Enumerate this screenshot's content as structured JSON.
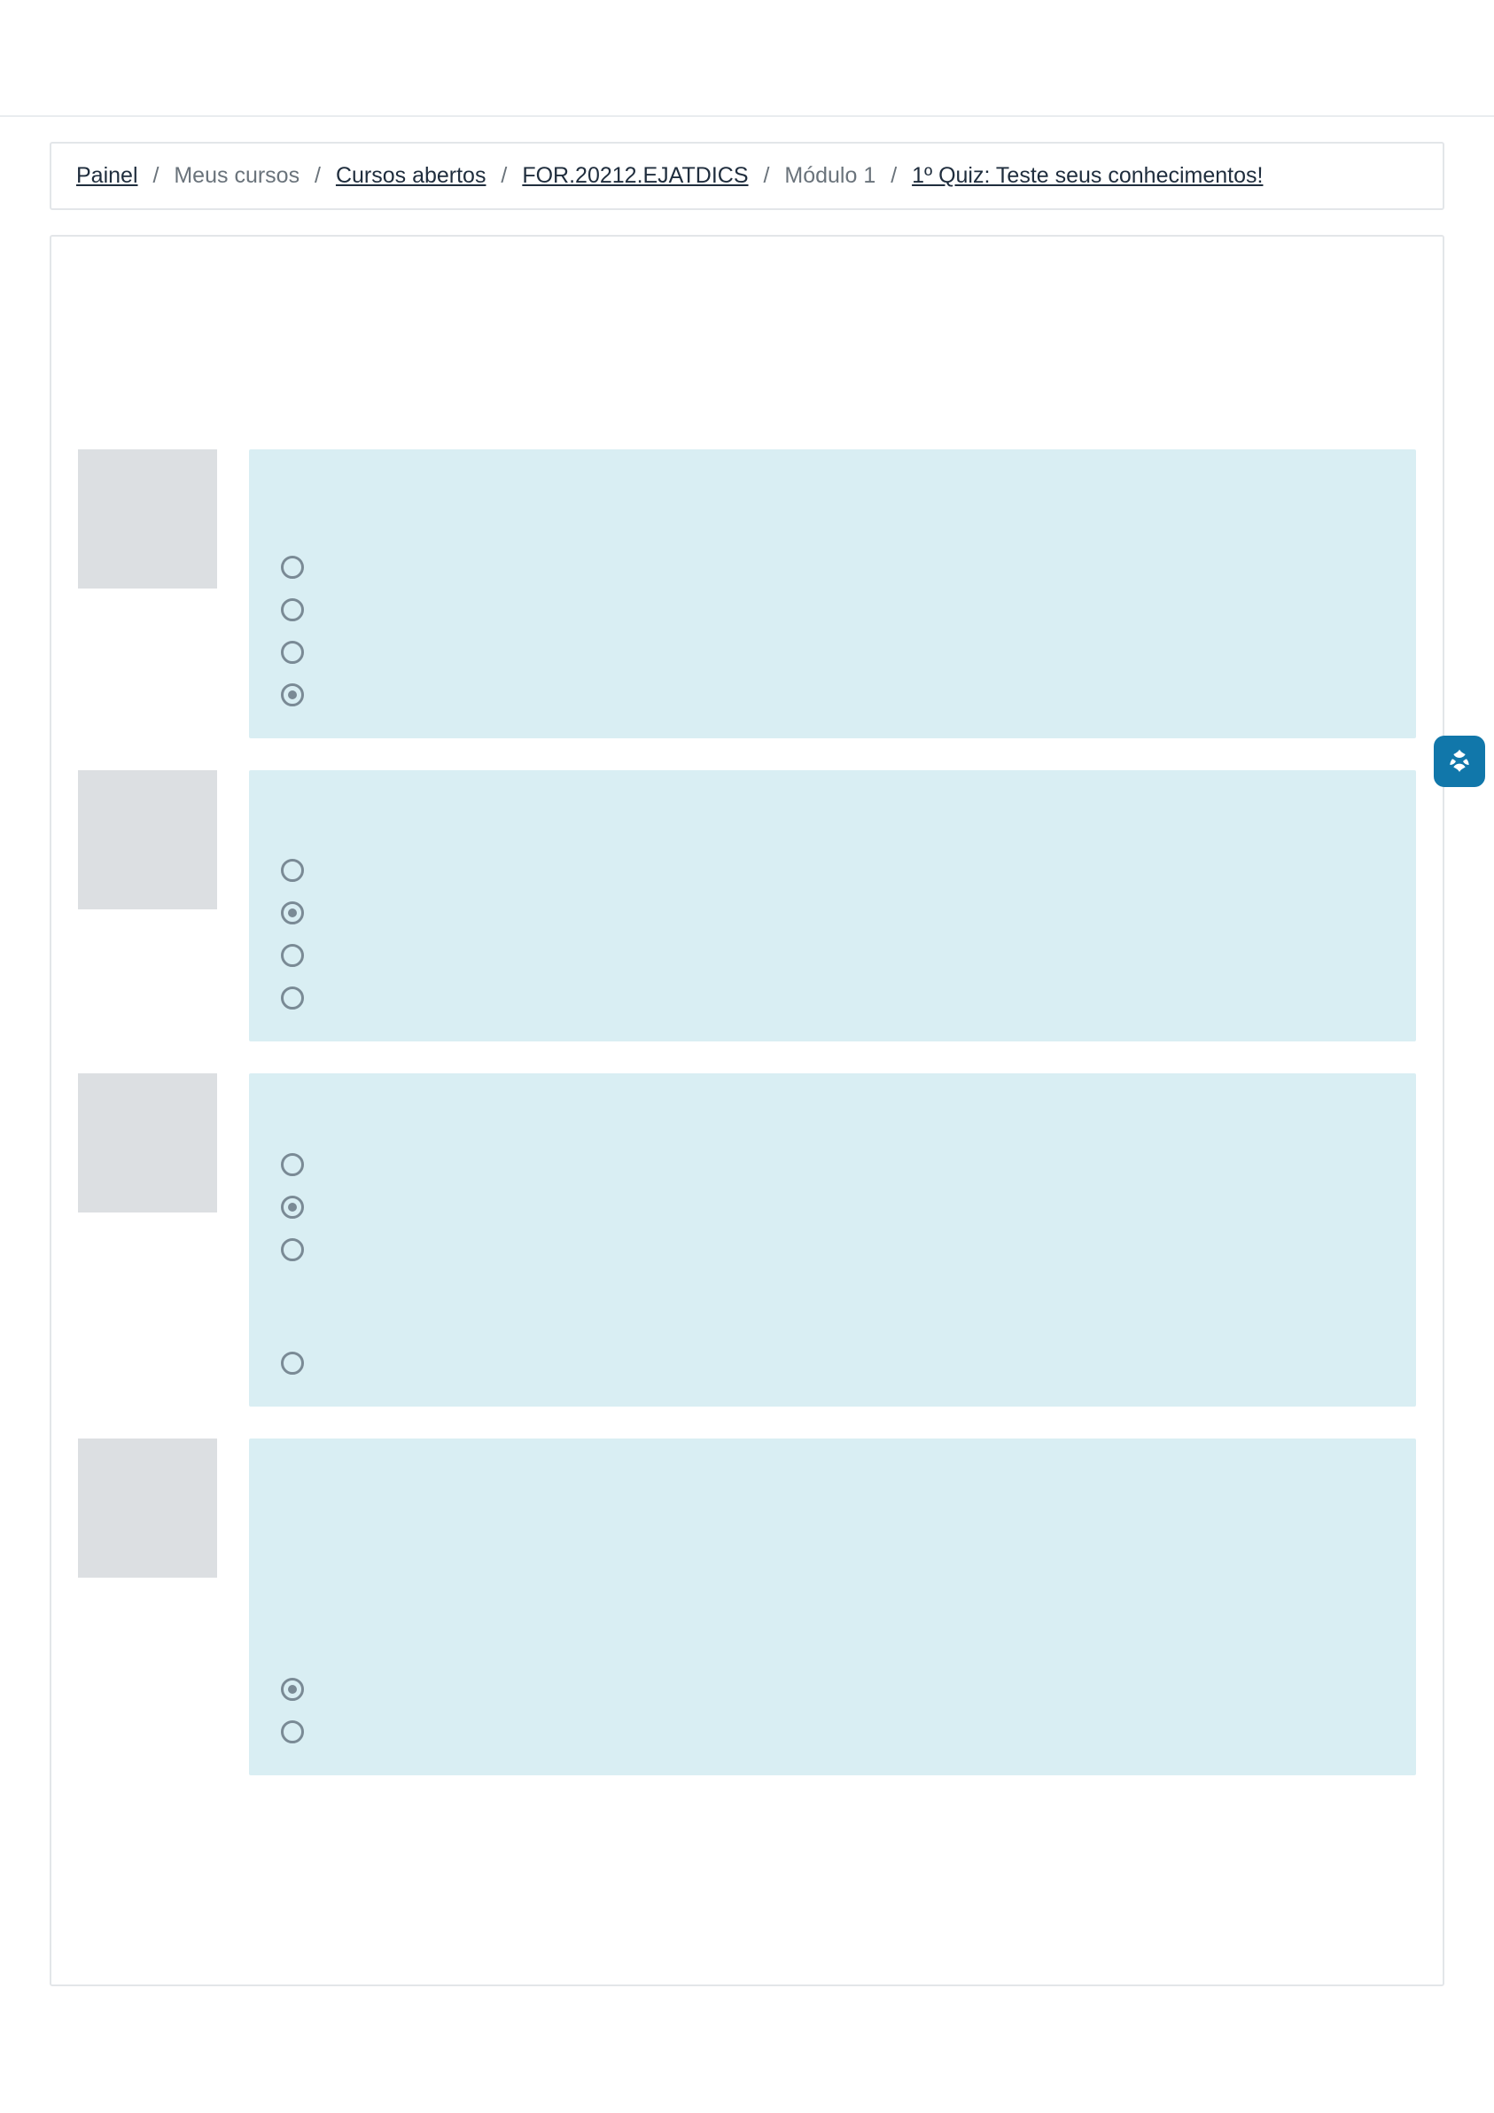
{
  "breadcrumb": {
    "painel": "Painel",
    "meus_cursos": "Meus cursos",
    "cursos_abertos": "Cursos abertos",
    "course_code": "FOR.20212.EJATDICS",
    "module": "Módulo 1",
    "quiz": "1º Quiz: Teste seus conhecimentos!"
  },
  "questions": [
    {
      "options": [
        {
          "checked": false
        },
        {
          "checked": false
        },
        {
          "checked": false
        },
        {
          "checked": true
        }
      ]
    },
    {
      "options": [
        {
          "checked": false
        },
        {
          "checked": true
        },
        {
          "checked": false
        },
        {
          "checked": false
        }
      ]
    },
    {
      "options": [
        {
          "checked": false
        },
        {
          "checked": true
        },
        {
          "checked": false
        },
        {
          "checked": false
        }
      ]
    },
    {
      "options": [
        {
          "checked": true
        },
        {
          "checked": false
        }
      ]
    }
  ],
  "floating_button": {
    "name": "accessibility-libras-icon"
  }
}
